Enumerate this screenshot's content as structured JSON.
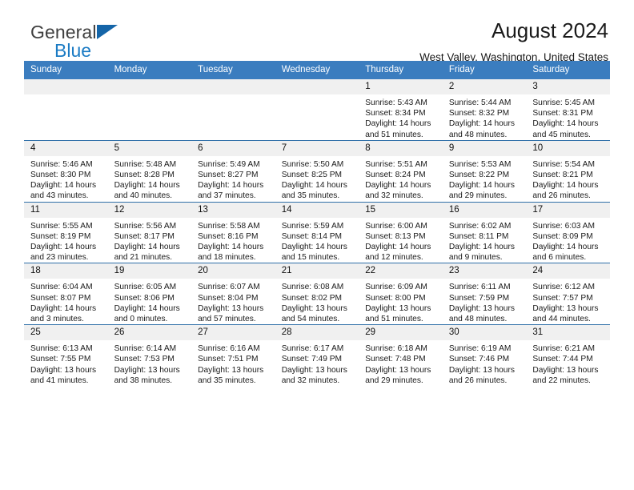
{
  "brand": {
    "name_top": "General",
    "name_bottom": "Blue",
    "triangle_color": "#1565a8",
    "blue_color": "#1b7bc4"
  },
  "header": {
    "title": "August 2024",
    "subtitle": "West Valley, Washington, United States"
  },
  "theme": {
    "header_blue": "#3b7dbf",
    "daynum_gray": "#f0f0f0",
    "row_rule": "#2f6fa8"
  },
  "weekdays": [
    "Sunday",
    "Monday",
    "Tuesday",
    "Wednesday",
    "Thursday",
    "Friday",
    "Saturday"
  ],
  "weeks": [
    [
      {
        "day": "",
        "sunrise": "",
        "sunset": "",
        "daylight1": "",
        "daylight2": ""
      },
      {
        "day": "",
        "sunrise": "",
        "sunset": "",
        "daylight1": "",
        "daylight2": ""
      },
      {
        "day": "",
        "sunrise": "",
        "sunset": "",
        "daylight1": "",
        "daylight2": ""
      },
      {
        "day": "",
        "sunrise": "",
        "sunset": "",
        "daylight1": "",
        "daylight2": ""
      },
      {
        "day": "1",
        "sunrise": "Sunrise: 5:43 AM",
        "sunset": "Sunset: 8:34 PM",
        "daylight1": "Daylight: 14 hours",
        "daylight2": "and 51 minutes."
      },
      {
        "day": "2",
        "sunrise": "Sunrise: 5:44 AM",
        "sunset": "Sunset: 8:32 PM",
        "daylight1": "Daylight: 14 hours",
        "daylight2": "and 48 minutes."
      },
      {
        "day": "3",
        "sunrise": "Sunrise: 5:45 AM",
        "sunset": "Sunset: 8:31 PM",
        "daylight1": "Daylight: 14 hours",
        "daylight2": "and 45 minutes."
      }
    ],
    [
      {
        "day": "4",
        "sunrise": "Sunrise: 5:46 AM",
        "sunset": "Sunset: 8:30 PM",
        "daylight1": "Daylight: 14 hours",
        "daylight2": "and 43 minutes."
      },
      {
        "day": "5",
        "sunrise": "Sunrise: 5:48 AM",
        "sunset": "Sunset: 8:28 PM",
        "daylight1": "Daylight: 14 hours",
        "daylight2": "and 40 minutes."
      },
      {
        "day": "6",
        "sunrise": "Sunrise: 5:49 AM",
        "sunset": "Sunset: 8:27 PM",
        "daylight1": "Daylight: 14 hours",
        "daylight2": "and 37 minutes."
      },
      {
        "day": "7",
        "sunrise": "Sunrise: 5:50 AM",
        "sunset": "Sunset: 8:25 PM",
        "daylight1": "Daylight: 14 hours",
        "daylight2": "and 35 minutes."
      },
      {
        "day": "8",
        "sunrise": "Sunrise: 5:51 AM",
        "sunset": "Sunset: 8:24 PM",
        "daylight1": "Daylight: 14 hours",
        "daylight2": "and 32 minutes."
      },
      {
        "day": "9",
        "sunrise": "Sunrise: 5:53 AM",
        "sunset": "Sunset: 8:22 PM",
        "daylight1": "Daylight: 14 hours",
        "daylight2": "and 29 minutes."
      },
      {
        "day": "10",
        "sunrise": "Sunrise: 5:54 AM",
        "sunset": "Sunset: 8:21 PM",
        "daylight1": "Daylight: 14 hours",
        "daylight2": "and 26 minutes."
      }
    ],
    [
      {
        "day": "11",
        "sunrise": "Sunrise: 5:55 AM",
        "sunset": "Sunset: 8:19 PM",
        "daylight1": "Daylight: 14 hours",
        "daylight2": "and 23 minutes."
      },
      {
        "day": "12",
        "sunrise": "Sunrise: 5:56 AM",
        "sunset": "Sunset: 8:17 PM",
        "daylight1": "Daylight: 14 hours",
        "daylight2": "and 21 minutes."
      },
      {
        "day": "13",
        "sunrise": "Sunrise: 5:58 AM",
        "sunset": "Sunset: 8:16 PM",
        "daylight1": "Daylight: 14 hours",
        "daylight2": "and 18 minutes."
      },
      {
        "day": "14",
        "sunrise": "Sunrise: 5:59 AM",
        "sunset": "Sunset: 8:14 PM",
        "daylight1": "Daylight: 14 hours",
        "daylight2": "and 15 minutes."
      },
      {
        "day": "15",
        "sunrise": "Sunrise: 6:00 AM",
        "sunset": "Sunset: 8:13 PM",
        "daylight1": "Daylight: 14 hours",
        "daylight2": "and 12 minutes."
      },
      {
        "day": "16",
        "sunrise": "Sunrise: 6:02 AM",
        "sunset": "Sunset: 8:11 PM",
        "daylight1": "Daylight: 14 hours",
        "daylight2": "and 9 minutes."
      },
      {
        "day": "17",
        "sunrise": "Sunrise: 6:03 AM",
        "sunset": "Sunset: 8:09 PM",
        "daylight1": "Daylight: 14 hours",
        "daylight2": "and 6 minutes."
      }
    ],
    [
      {
        "day": "18",
        "sunrise": "Sunrise: 6:04 AM",
        "sunset": "Sunset: 8:07 PM",
        "daylight1": "Daylight: 14 hours",
        "daylight2": "and 3 minutes."
      },
      {
        "day": "19",
        "sunrise": "Sunrise: 6:05 AM",
        "sunset": "Sunset: 8:06 PM",
        "daylight1": "Daylight: 14 hours",
        "daylight2": "and 0 minutes."
      },
      {
        "day": "20",
        "sunrise": "Sunrise: 6:07 AM",
        "sunset": "Sunset: 8:04 PM",
        "daylight1": "Daylight: 13 hours",
        "daylight2": "and 57 minutes."
      },
      {
        "day": "21",
        "sunrise": "Sunrise: 6:08 AM",
        "sunset": "Sunset: 8:02 PM",
        "daylight1": "Daylight: 13 hours",
        "daylight2": "and 54 minutes."
      },
      {
        "day": "22",
        "sunrise": "Sunrise: 6:09 AM",
        "sunset": "Sunset: 8:00 PM",
        "daylight1": "Daylight: 13 hours",
        "daylight2": "and 51 minutes."
      },
      {
        "day": "23",
        "sunrise": "Sunrise: 6:11 AM",
        "sunset": "Sunset: 7:59 PM",
        "daylight1": "Daylight: 13 hours",
        "daylight2": "and 48 minutes."
      },
      {
        "day": "24",
        "sunrise": "Sunrise: 6:12 AM",
        "sunset": "Sunset: 7:57 PM",
        "daylight1": "Daylight: 13 hours",
        "daylight2": "and 44 minutes."
      }
    ],
    [
      {
        "day": "25",
        "sunrise": "Sunrise: 6:13 AM",
        "sunset": "Sunset: 7:55 PM",
        "daylight1": "Daylight: 13 hours",
        "daylight2": "and 41 minutes."
      },
      {
        "day": "26",
        "sunrise": "Sunrise: 6:14 AM",
        "sunset": "Sunset: 7:53 PM",
        "daylight1": "Daylight: 13 hours",
        "daylight2": "and 38 minutes."
      },
      {
        "day": "27",
        "sunrise": "Sunrise: 6:16 AM",
        "sunset": "Sunset: 7:51 PM",
        "daylight1": "Daylight: 13 hours",
        "daylight2": "and 35 minutes."
      },
      {
        "day": "28",
        "sunrise": "Sunrise: 6:17 AM",
        "sunset": "Sunset: 7:49 PM",
        "daylight1": "Daylight: 13 hours",
        "daylight2": "and 32 minutes."
      },
      {
        "day": "29",
        "sunrise": "Sunrise: 6:18 AM",
        "sunset": "Sunset: 7:48 PM",
        "daylight1": "Daylight: 13 hours",
        "daylight2": "and 29 minutes."
      },
      {
        "day": "30",
        "sunrise": "Sunrise: 6:19 AM",
        "sunset": "Sunset: 7:46 PM",
        "daylight1": "Daylight: 13 hours",
        "daylight2": "and 26 minutes."
      },
      {
        "day": "31",
        "sunrise": "Sunrise: 6:21 AM",
        "sunset": "Sunset: 7:44 PM",
        "daylight1": "Daylight: 13 hours",
        "daylight2": "and 22 minutes."
      }
    ]
  ]
}
